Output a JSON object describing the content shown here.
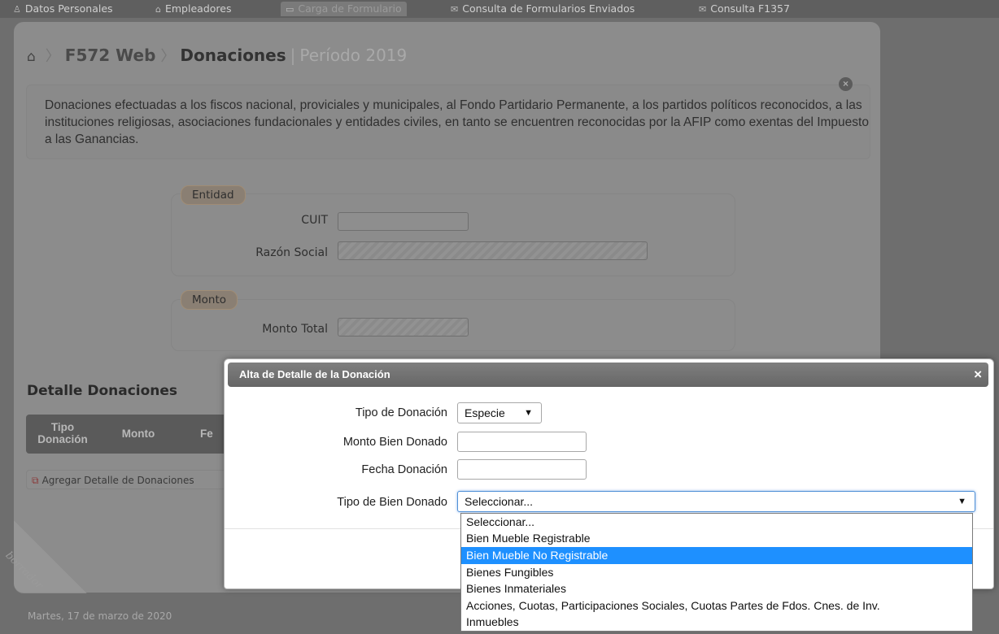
{
  "nav": {
    "items": [
      {
        "icon": "♙",
        "label": "Datos Personales"
      },
      {
        "icon": "⌂",
        "label": "Empleadores"
      },
      {
        "icon": "▭",
        "label": "Carga de Formulario"
      },
      {
        "icon": "✉",
        "label": "Consulta de Formularios Enviados"
      },
      {
        "icon": "✉",
        "label": "Consulta F1357"
      }
    ]
  },
  "breadcrumb": {
    "home_icon": "⌂",
    "app": "F572 Web",
    "page": "Donaciones",
    "period": "Período 2019"
  },
  "info": {
    "text": "Donaciones efectuadas a los fiscos nacional, proviciales y municipales, al Fondo Partidario Permanente, a los partidos políticos reconocidos, a las instituciones religiosas, asociaciones fundacionales y entidades civiles, en tanto se encuentren reconocidas por la AFIP como exentas del Impuesto a las Ganancias.",
    "close_icon": "×"
  },
  "entidad": {
    "legend": "Entidad",
    "cuit_label": "CUIT",
    "cuit_value": "",
    "razon_label": "Razón Social",
    "razon_value": ""
  },
  "monto": {
    "legend": "Monto",
    "total_label": "Monto Total",
    "total_value": ""
  },
  "detalle": {
    "title": "Detalle Donaciones",
    "columns": [
      "Tipo Donación",
      "Monto",
      "Fe"
    ],
    "add_icon": "⧉",
    "add_label": "Agregar Detalle de Donaciones"
  },
  "watermark": "borrador",
  "footer": {
    "date": "Martes, 17 de marzo de 2020"
  },
  "modal": {
    "title": "Alta de Detalle de la Donación",
    "close_icon": "×",
    "tipo_donacion_label": "Tipo de Donación",
    "tipo_donacion_value": "Especie",
    "monto_bien_label": "Monto Bien Donado",
    "monto_bien_value": "",
    "fecha_label": "Fecha Donación",
    "fecha_value": "",
    "tipo_bien_label": "Tipo de Bien Donado",
    "tipo_bien_value": "Seleccionar...",
    "arrow": "▼"
  },
  "dropdown": {
    "options": [
      "Seleccionar...",
      "Bien Mueble Registrable",
      "Bien Mueble No Registrable",
      "Bienes Fungibles",
      "Bienes Inmateriales",
      "Acciones, Cuotas, Participaciones Sociales, Cuotas Partes de Fdos. Cnes. de Inv.",
      "Inmuebles"
    ],
    "highlighted": "Bien Mueble No Registrable"
  },
  "colors": {
    "overlay_gray": "#8c8c8c",
    "modal_header": "#6e6e6e",
    "dropdown_highlight": "#1e90ff"
  }
}
